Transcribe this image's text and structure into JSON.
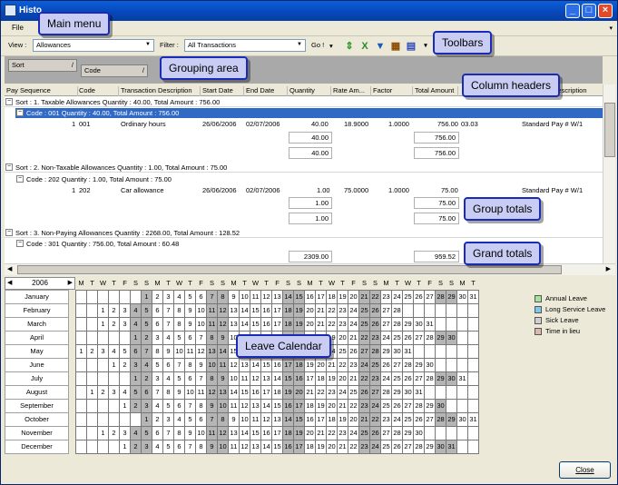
{
  "window": {
    "title": "Histo"
  },
  "menu": {
    "file": "File"
  },
  "toolbar": {
    "view_label": "View :",
    "view_value": "Allowances",
    "filter_label": "Filter :",
    "filter_value": "All Transactions",
    "go_label": "Go !"
  },
  "grouping": {
    "sort_chip": "Sort",
    "code_chip": "Code"
  },
  "columns": [
    "Pay Sequence",
    "Code",
    "Transaction Description",
    "Start Date",
    "End Date",
    "Quantity",
    "Rate Am...",
    "Factor",
    "Total Amount",
    "Description"
  ],
  "groups": [
    {
      "sort_label": "Sort : 1. Taxable Allowances Quantity : 40.00, Total Amount : 756.00",
      "code_label": "Code : 001 Quantity : 40.00, Total Amount : 756.00",
      "row": {
        "seq": "1",
        "code": "001",
        "desc": "Ordinary hours",
        "start": "26/06/2006",
        "end": "02/07/2006",
        "qty": "40.00",
        "rate": "18.9000",
        "factor": "1.0000",
        "total": "756.00",
        "x": "03.03",
        "pay": "Standard Pay # W/1"
      },
      "code_total_qty": "40.00",
      "code_total_amt": "756.00",
      "sort_total_qty": "40.00",
      "sort_total_amt": "756.00"
    },
    {
      "sort_label": "Sort : 2. Non-Taxable Allowances Quantity : 1.00, Total Amount : 75.00",
      "code_label": "Code : 202 Quantity : 1.00, Total Amount : 75.00",
      "row": {
        "seq": "1",
        "code": "202",
        "desc": "Car allowance",
        "start": "26/06/2006",
        "end": "02/07/2006",
        "qty": "1.00",
        "rate": "75.0000",
        "factor": "1.0000",
        "total": "75.00",
        "x": "",
        "pay": "Standard Pay # W/1"
      },
      "code_total_qty": "1.00",
      "code_total_amt": "75.00",
      "sort_total_qty": "1.00",
      "sort_total_amt": "75.00"
    },
    {
      "sort_label": "Sort : 3. Non-Paying Allowances Quantity : 2268.00, Total Amount : 128.52",
      "code_label": "Code : 301 Quantity : 756.00, Total Amount : 60.48"
    }
  ],
  "grand_total": {
    "qty": "2309.00",
    "amt": "959.52"
  },
  "calendar": {
    "year": "2006",
    "weekdays": [
      "M",
      "T",
      "W",
      "T",
      "F",
      "S",
      "S",
      "M",
      "T",
      "W",
      "T",
      "F",
      "S",
      "S",
      "M",
      "T",
      "W",
      "T",
      "F",
      "S",
      "S",
      "M",
      "T",
      "W",
      "T",
      "F",
      "S",
      "S",
      "M",
      "T",
      "W",
      "T",
      "F",
      "S",
      "S",
      "M",
      "T"
    ],
    "months": [
      {
        "name": "January",
        "offset": 6,
        "days": 31
      },
      {
        "name": "February",
        "offset": 2,
        "days": 28
      },
      {
        "name": "March",
        "offset": 2,
        "days": 31
      },
      {
        "name": "April",
        "offset": 5,
        "days": 30
      },
      {
        "name": "May",
        "offset": 0,
        "days": 31
      },
      {
        "name": "June",
        "offset": 3,
        "days": 30
      },
      {
        "name": "July",
        "offset": 5,
        "days": 31
      },
      {
        "name": "August",
        "offset": 1,
        "days": 31
      },
      {
        "name": "September",
        "offset": 4,
        "days": 30
      },
      {
        "name": "October",
        "offset": 6,
        "days": 31
      },
      {
        "name": "November",
        "offset": 2,
        "days": 30
      },
      {
        "name": "December",
        "offset": 4,
        "days": 31
      }
    ]
  },
  "legend": [
    {
      "label": "Annual Leave",
      "color": "#a8e0a0"
    },
    {
      "label": "Long Service Leave",
      "color": "#7fc8ec"
    },
    {
      "label": "Sick Leave",
      "color": "#d0d0d0"
    },
    {
      "label": "Time in lieu",
      "color": "#d8b8b0"
    }
  ],
  "close_button": "Close",
  "callouts": {
    "main_menu": "Main menu",
    "toolbars": "Toolbars",
    "grouping_area": "Grouping area",
    "column_headers": "Column headers",
    "group_totals": "Group totals",
    "grand_totals": "Grand totals",
    "leave_calendar": "Leave Calendar"
  }
}
